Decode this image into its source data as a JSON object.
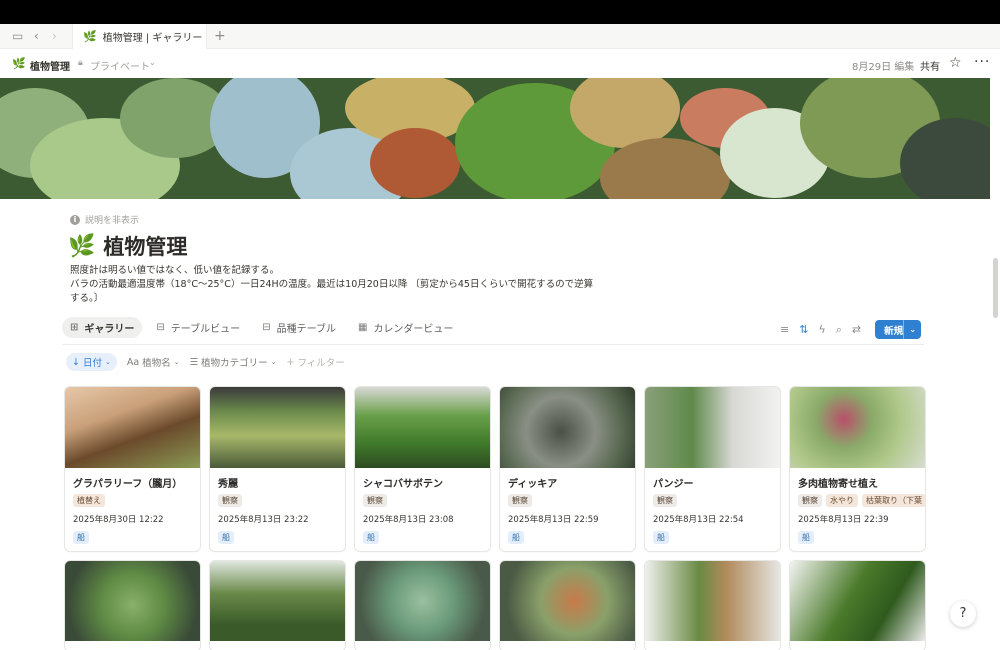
{
  "tab": {
    "title": "植物管理 | ギャラリー",
    "new_tab": "+"
  },
  "topbar": {
    "title": "植物管理",
    "privacy": "プライベート",
    "edited": "8月29日 編集",
    "share": "共有"
  },
  "page": {
    "toggle_description": "説明を非表示",
    "title": "植物管理",
    "description": [
      "照度計は明るい値ではなく、低い値を記録する。",
      "バラの活動最適温度帯（18°C～25°C）一日24Hの温度。最近は10月20日以降 〔剪定から45日くらいで開花するので逆算",
      "する。〕"
    ]
  },
  "views": [
    {
      "label": "ギャラリー",
      "icon": "gallery-icon",
      "active": true
    },
    {
      "label": "テーブルビュー",
      "icon": "table-icon",
      "active": false
    },
    {
      "label": "品種テーブル",
      "icon": "table-icon",
      "active": false
    },
    {
      "label": "カレンダービュー",
      "icon": "calendar-icon",
      "active": false
    }
  ],
  "toolbar": {
    "new_label": "新規"
  },
  "filters": [
    {
      "label": "日付",
      "prefix": "↓",
      "active": true
    },
    {
      "label": "植物名",
      "prefix": "Aa",
      "active": false
    },
    {
      "label": "植物カテゴリー",
      "prefix": "☰",
      "active": false
    },
    {
      "label": "フィルター",
      "prefix": "+",
      "active": false
    }
  ],
  "cards": [
    {
      "title": "グラパラリーフ（朧月）",
      "tags": [
        "植替え"
      ],
      "date": "2025年8月30日 12:22",
      "location": "船"
    },
    {
      "title": "秀麗",
      "tags": [
        "観察"
      ],
      "date": "2025年8月13日 23:22",
      "location": "船"
    },
    {
      "title": "シャコバサボテン",
      "tags": [
        "観察"
      ],
      "date": "2025年8月13日 23:08",
      "location": "船"
    },
    {
      "title": "ディッキア",
      "tags": [
        "観察"
      ],
      "date": "2025年8月13日 22:59",
      "location": "船"
    },
    {
      "title": "パンジー",
      "tags": [
        "観察"
      ],
      "date": "2025年8月13日 22:54",
      "location": "船"
    },
    {
      "title": "多肉植物寄せ植え",
      "tags": [
        "観察",
        "水やり",
        "枯葉取り（下葉"
      ],
      "date": "2025年8月13日 22:39",
      "location": "船"
    }
  ],
  "colors": {
    "accent": "#2f80d1",
    "brand_leaf": "#3e8a2e"
  }
}
